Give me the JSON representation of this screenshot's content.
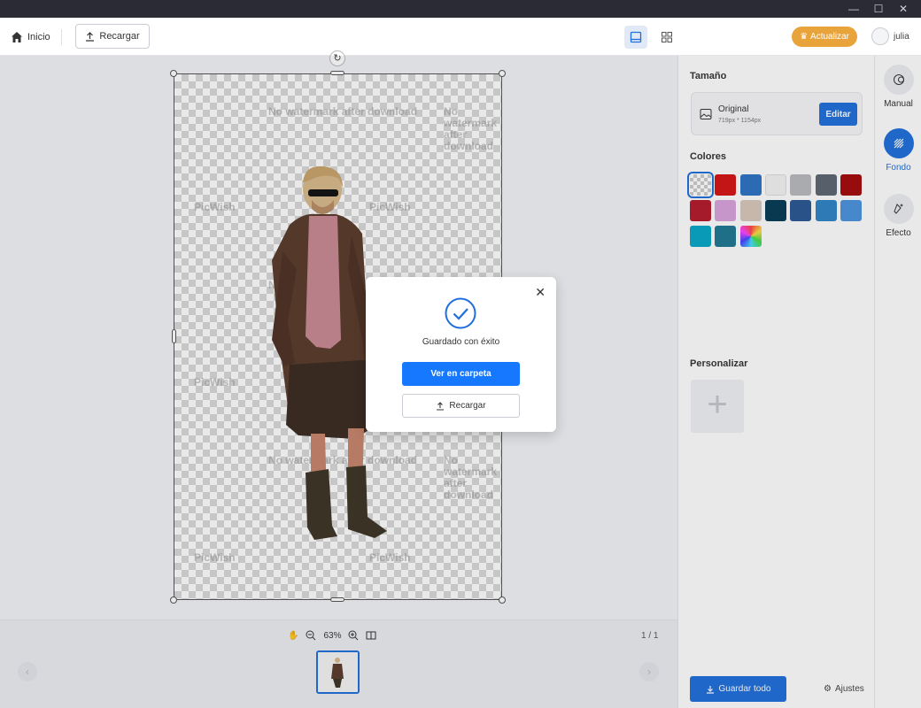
{
  "toolbar": {
    "home_label": "Inicio",
    "reload_label": "Recargar",
    "upgrade_label": "Actualizar",
    "user_name": "julia"
  },
  "canvas": {
    "watermarks": [
      "No watermark after download",
      "PicWish"
    ],
    "subject": "person-cutout"
  },
  "bottom": {
    "zoom": "63%",
    "pager": "1 / 1"
  },
  "right_panel": {
    "size_title": "Tamaño",
    "size_name": "Original",
    "size_dims": "719px * 1154px",
    "edit_label": "Editar",
    "colors_title": "Colores",
    "custom_title": "Personalizar",
    "save_all_label": "Guardar todo",
    "settings_label": "Ajustes"
  },
  "swatches": [
    {
      "type": "transparent",
      "selected": true
    },
    {
      "color": "#d51313"
    },
    {
      "color": "#2e72c3"
    },
    {
      "color": "#f3f3f3"
    },
    {
      "color": "#b9babd"
    },
    {
      "color": "#5d6672"
    },
    {
      "color": "#a40a0a"
    },
    {
      "color": "#b51a2b"
    },
    {
      "color": "#d8a3dd"
    },
    {
      "color": "#d8c8bb"
    },
    {
      "color": "#063a55"
    },
    {
      "color": "#2a5793"
    },
    {
      "color": "#2f84c7"
    },
    {
      "color": "#4b93df"
    },
    {
      "color": "#06a8c8"
    },
    {
      "color": "#207894"
    },
    {
      "type": "rainbow"
    }
  ],
  "side_tools": {
    "manual": "Manual",
    "fondo": "Fondo",
    "efecto": "Efecto"
  },
  "dialog": {
    "message": "Guardado con éxito",
    "primary_label": "Ver en carpeta",
    "secondary_label": "Recargar"
  },
  "colors": {
    "accent": "#1f6fdb",
    "primary_button": "#1677ff",
    "upgrade": "#e8a33a",
    "titlebar": "#2b2b35"
  }
}
